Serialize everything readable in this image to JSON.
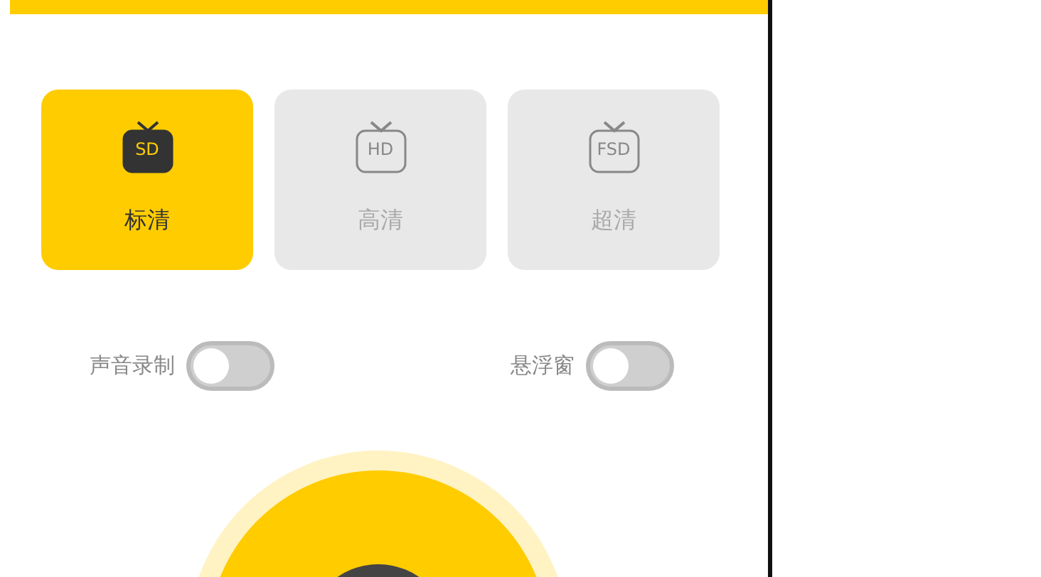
{
  "qualities": [
    {
      "code": "SD",
      "label": "标清",
      "selected": true
    },
    {
      "code": "HD",
      "label": "高清",
      "selected": false
    },
    {
      "code": "FSD",
      "label": "超清",
      "selected": false
    }
  ],
  "toggles": [
    {
      "label": "声音录制",
      "on": false
    },
    {
      "label": "悬浮窗",
      "on": false
    }
  ]
}
